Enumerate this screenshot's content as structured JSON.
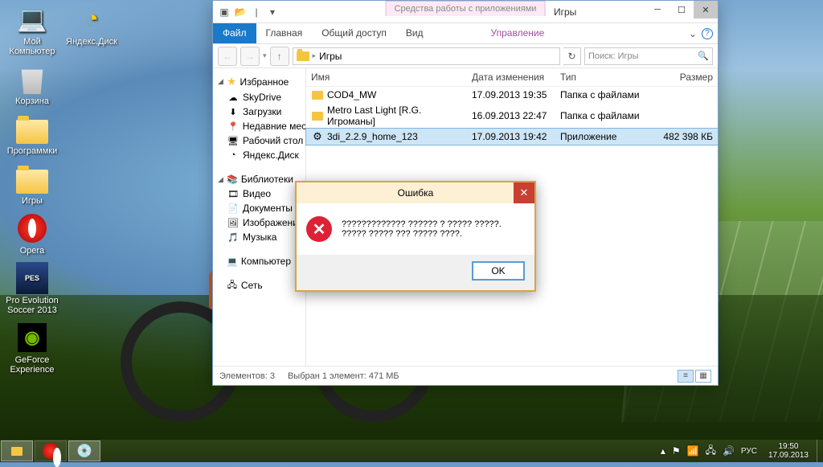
{
  "desktop": {
    "icons": [
      {
        "label": "Мой Компьютер",
        "kind": "pc"
      },
      {
        "label": "Яндекс.Диск",
        "kind": "ydisk",
        "col2": true
      },
      {
        "label": "Корзина",
        "kind": "bin"
      },
      {
        "label": "Программки",
        "kind": "folder"
      },
      {
        "label": "Игры",
        "kind": "folder"
      },
      {
        "label": "Opera",
        "kind": "opera"
      },
      {
        "label": "Pro Evolution Soccer 2013",
        "kind": "pes"
      },
      {
        "label": "GeForce Experience",
        "kind": "nvidia"
      }
    ]
  },
  "explorer": {
    "title": "Игры",
    "context_label": "Средства работы с приложениями",
    "ribbon": {
      "file": "Файл",
      "tabs": [
        "Главная",
        "Общий доступ",
        "Вид"
      ],
      "contextual": "Управление"
    },
    "help_tip": "?",
    "nav": {
      "back": "←",
      "forward": "→",
      "up": "↑",
      "breadcrumb": [
        "Игры"
      ],
      "refresh": "↻",
      "search_placeholder": "Поиск: Игры"
    },
    "navpane": {
      "favorites": {
        "head": "Избранное",
        "items": [
          "SkyDrive",
          "Загрузки",
          "Недавние места",
          "Рабочий стол",
          "Яндекс.Диск"
        ]
      },
      "libraries": {
        "head": "Библиотеки",
        "items": [
          "Видео",
          "Документы",
          "Изображения",
          "Музыка"
        ]
      },
      "computer": "Компьютер",
      "network": "Сеть"
    },
    "columns": {
      "name": "Имя",
      "date": "Дата изменения",
      "type": "Тип",
      "size": "Размер"
    },
    "files": [
      {
        "name": "COD4_MW",
        "date": "17.09.2013 19:35",
        "type": "Папка с файлами",
        "size": "",
        "kind": "folder"
      },
      {
        "name": "Metro Last Light [R.G. Игроманы]",
        "date": "16.09.2013 22:47",
        "type": "Папка с файлами",
        "size": "",
        "kind": "folder"
      },
      {
        "name": "3di_2.2.9_home_123",
        "date": "17.09.2013 19:42",
        "type": "Приложение",
        "size": "482 398 КБ",
        "kind": "exe",
        "selected": true
      }
    ],
    "status": {
      "count": "Элементов: 3",
      "selection": "Выбран 1 элемент: 471 МБ"
    }
  },
  "dialog": {
    "title": "Ошибка",
    "message": "????????????? ?????? ? ????? ?????. ????? ????? ??? ????? ????.",
    "ok": "OK"
  },
  "taskbar": {
    "lang": "РУС",
    "time": "19:50",
    "date": "17.09.2013"
  }
}
